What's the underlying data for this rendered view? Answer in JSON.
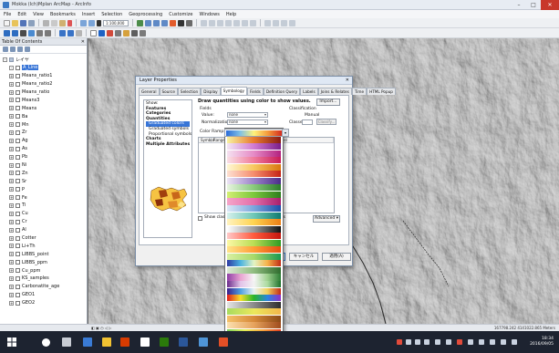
{
  "window": {
    "title": "Mokka (Ich)Mplan ArcMap - ArcInfo"
  },
  "menu": [
    "File",
    "Edit",
    "View",
    "Bookmarks",
    "Insert",
    "Selection",
    "Geoprocessing",
    "Customize",
    "Windows",
    "Help"
  ],
  "toolbar": {
    "scale": "1:100,000"
  },
  "toc": {
    "title": "Table Of Contents",
    "items": [
      {
        "label": "レイヤ",
        "indent": 0,
        "exp": "-",
        "layer": true
      },
      {
        "label": "A_Line",
        "indent": 1,
        "exp": "-",
        "selected": true
      },
      {
        "label": "Means_ratio1",
        "indent": 1,
        "exp": "+"
      },
      {
        "label": "Means_ratio2",
        "indent": 1,
        "exp": "+"
      },
      {
        "label": "Means_ratio",
        "indent": 1,
        "exp": "+"
      },
      {
        "label": "Means3",
        "indent": 1,
        "exp": "+"
      },
      {
        "label": "Means",
        "indent": 1,
        "exp": "+"
      },
      {
        "label": "Ba",
        "indent": 1,
        "exp": "+"
      },
      {
        "label": "Mn",
        "indent": 1,
        "exp": "+"
      },
      {
        "label": "Zr",
        "indent": 1,
        "exp": "+"
      },
      {
        "label": "Ag",
        "indent": 1,
        "exp": "+"
      },
      {
        "label": "As",
        "indent": 1,
        "exp": "+"
      },
      {
        "label": "Pb",
        "indent": 1,
        "exp": "+"
      },
      {
        "label": "Ni",
        "indent": 1,
        "exp": "+"
      },
      {
        "label": "Zn",
        "indent": 1,
        "exp": "+"
      },
      {
        "label": "Sr",
        "indent": 1,
        "exp": "+"
      },
      {
        "label": "P",
        "indent": 1,
        "exp": "+"
      },
      {
        "label": "Fe",
        "indent": 1,
        "exp": "+"
      },
      {
        "label": "Ti",
        "indent": 1,
        "exp": "+"
      },
      {
        "label": "Cu",
        "indent": 1,
        "exp": "+"
      },
      {
        "label": "Cr",
        "indent": 1,
        "exp": "+"
      },
      {
        "label": "Al",
        "indent": 1,
        "exp": "+"
      },
      {
        "label": "Cotter",
        "indent": 1,
        "exp": "+"
      },
      {
        "label": "Li+Th",
        "indent": 1,
        "exp": "+"
      },
      {
        "label": "LIBBS_point",
        "indent": 1,
        "exp": "+"
      },
      {
        "label": "LIBBS_ppm",
        "indent": 1,
        "exp": "+"
      },
      {
        "label": "Cu_ppm",
        "indent": 1,
        "exp": "+"
      },
      {
        "label": "KS_samples",
        "indent": 1,
        "exp": "+"
      },
      {
        "label": "Carbonatite_age",
        "indent": 1,
        "exp": "+"
      },
      {
        "label": "GEO1",
        "indent": 1,
        "exp": "+"
      },
      {
        "label": "GEO2",
        "indent": 1,
        "exp": "+"
      }
    ]
  },
  "dialog": {
    "title": "Layer Properties",
    "close": "✕",
    "tabs": [
      "General",
      "Source",
      "Selection",
      "Display",
      "Symbology",
      "Fields",
      "Definition Query",
      "Labels",
      "Joins & Relates",
      "Time",
      "HTML Popup"
    ],
    "active_tab": "Symbology",
    "show_label": "Show:",
    "show_items": [
      {
        "text": "Features",
        "bold": true
      },
      {
        "text": "Categories",
        "bold": true
      },
      {
        "text": "Quantities",
        "bold": true
      },
      {
        "text": "Graduated colors",
        "indent": true,
        "selected": true
      },
      {
        "text": "Graduated symbols",
        "indent": true
      },
      {
        "text": "Proportional symbols",
        "indent": true
      },
      {
        "text": "Charts",
        "bold": true
      },
      {
        "text": "Multiple Attributes",
        "bold": true
      }
    ],
    "heading": "Draw quantities using color to show values.",
    "import": "Import...",
    "fields_label": "Fields",
    "value_label": "Value:",
    "value": "none",
    "normalization_label": "Normalization:",
    "normalization": "none",
    "classification_label": "Classification",
    "classification_method": "Manual",
    "classes_label": "Classes:",
    "classify": "Classify...",
    "color_ramp_label": "Color Ramp:",
    "col_symbol": "Symbol",
    "col_range": "Range",
    "col_label": "Label",
    "draw_bg": "Show class ranges using feature values",
    "advanced": "Advanced ▾",
    "ok": "OK",
    "cancel": "キャンセル",
    "apply": "適用(A)"
  },
  "color_ramps": [
    [
      "#2b6bd8",
      "#7ec0e6",
      "#fff27a",
      "#f59a3c",
      "#d42b1e"
    ],
    [
      "#f8f2a0",
      "#e77a2e",
      "#8a1a14"
    ],
    [
      "#f3e6f3",
      "#d07ad3",
      "#7a1e8a"
    ],
    [
      "#f5e1f0",
      "#e58ac6",
      "#b3217f"
    ],
    [
      "#f9e0e6",
      "#ef7a9c",
      "#c81b58"
    ],
    [
      "#fff6d5",
      "#f7c75f",
      "#d8760f"
    ],
    [
      "#fde0d2",
      "#f58c6c",
      "#c42315"
    ],
    [
      "#ece4f4",
      "#9b82c9",
      "#4a2c8a"
    ],
    [
      "#e8f4e0",
      "#88c97a",
      "#2c7d2a"
    ],
    [
      "#d4ef73",
      "#7bc83c",
      "#2d7d1d"
    ],
    [
      "#f5a5c9",
      "#e36ea9",
      "#a71f6c"
    ],
    [
      "#dbe8f6",
      "#7aa6dd",
      "#1c4fa8"
    ],
    [
      "#d5f0ec",
      "#6ec7b6",
      "#0f7b70"
    ],
    [
      "#fff3c0",
      "#ffd34f",
      "#ec7e14"
    ],
    [
      "#ffffff",
      "#9a9a9a",
      "#101010"
    ],
    [
      "#ffc9c9",
      "#ff5a3d",
      "#c3160e"
    ],
    [
      "#fdf8a6",
      "#b9dd54",
      "#2e9c24"
    ],
    [
      "#ffe48a",
      "#ff9d36",
      "#e24d12"
    ],
    [
      "#d9f0a3",
      "#a6d96a",
      "#1a9850"
    ],
    [
      "#2e3aa3",
      "#4bb3e0",
      "#e2f4c4",
      "#f6b24a",
      "#bf2a16"
    ],
    [
      "#dce9d6",
      "#90bc7f",
      "#2f6c2e"
    ],
    [
      "#8e3ea6",
      "#e9a3d1",
      "#f7f7f7",
      "#9ed08e",
      "#2a7b33"
    ],
    [
      "#6b2b8a",
      "#e2c3e9",
      "#f3f3f3",
      "#acdba0",
      "#1b6f2a"
    ],
    [
      "#3b1d8a",
      "#4fa0e0",
      "#e8f2f2",
      "#f2d15a",
      "#c22816"
    ],
    [
      "#e21c1c",
      "#f7df2a",
      "#27b52a",
      "#2b84e0",
      "#8e2fc6"
    ],
    [
      "#e5e5e5",
      "#8a8a8a",
      "#2d2d2d"
    ],
    [
      "#a8dc5f",
      "#ebe85c",
      "#f2b64b"
    ],
    [
      "#f5c26b",
      "#d6893a",
      "#8b4a17"
    ],
    [
      "#fbe0b0",
      "#e6a35d",
      "#9f4b1c"
    ],
    [
      "#7ccf5c",
      "#e4eb55",
      "#f7a13b",
      "#de3c1f"
    ],
    [
      "#9d1f1a",
      "#f0a24c",
      "#f6f1c2"
    ],
    [
      "#11a6a0",
      "#7fdec0",
      "#f6f0b5"
    ],
    [
      "#c8e79a",
      "#5aba4d",
      "#0e7f3b"
    ],
    [
      "#f5a840",
      "#f8e07a",
      "#b6d865"
    ]
  ],
  "status": {
    "coords": "167798.242  4141022.865 Meters"
  },
  "taskbar": {
    "time": "18:34",
    "date": "2016/09/05"
  }
}
